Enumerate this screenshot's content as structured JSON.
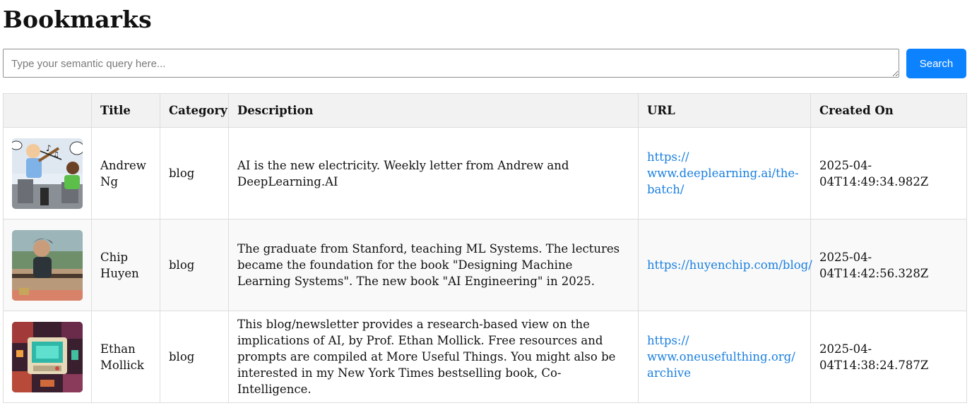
{
  "page": {
    "title": "Bookmarks"
  },
  "search": {
    "placeholder": "Type your semantic query here...",
    "button_label": "Search"
  },
  "table": {
    "headers": [
      "",
      "Title",
      "Category",
      "Description",
      "URL",
      "Created On"
    ],
    "rows": [
      {
        "thumbnail": "cartoon-violinist-image",
        "title": "Andrew Ng",
        "category": "blog",
        "description": "AI is the new electricity. Weekly letter from Andrew and DeepLearning.AI",
        "url": "https://www.deeplearning.ai/the-batch/",
        "url_lines": [
          "https://",
          "www.deeplearning.ai/the-",
          "batch/"
        ],
        "created_on": "2025-04-04T14:49:34.982Z"
      },
      {
        "thumbnail": "person-portrait-photo",
        "title": "Chip Huyen",
        "category": "blog",
        "description": "The graduate from Stanford, teaching ML Systems. The lectures became the foundation for the book \"Designing Machine Learning Systems\". The new book \"AI Engineering\" in 2025.",
        "url": "https://huyenchip.com/blog/",
        "url_lines": [
          "https://huyenchip.com/blog/"
        ],
        "created_on": "2025-04-04T14:42:56.328Z"
      },
      {
        "thumbnail": "pixel-art-computer-image",
        "title": "Ethan Mollick",
        "category": "blog",
        "description": "This blog/newsletter provides a research-based view on the implications of AI, by Prof. Ethan Mollick. Free resources and prompts are compiled at More Useful Things. You might also be interested in my New York Times bestselling book, Co-Intelligence.",
        "url": "https://www.oneusefulthing.org/archive",
        "url_lines": [
          "https://",
          "www.oneusefulthing.org/",
          "archive"
        ],
        "created_on": "2025-04-04T14:38:24.787Z"
      }
    ]
  },
  "colors": {
    "search_button": "#0d82ff",
    "link": "#1a7fe0",
    "header_bg": "#f2f2f2",
    "border": "#dddddd"
  }
}
